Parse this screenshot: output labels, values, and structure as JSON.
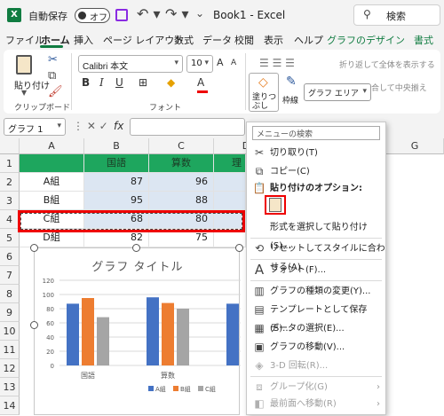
{
  "titlebar": {
    "autosave_label": "自動保存",
    "autosave_state": "オフ",
    "doc_title": "Book1  -  Excel",
    "search_label": "検索"
  },
  "tabs": [
    "ファイル",
    "ホーム",
    "挿入",
    "ページ レイアウト",
    "数式",
    "データ",
    "校閲",
    "表示",
    "ヘルプ",
    "グラフのデザイン",
    "書式"
  ],
  "ribbon": {
    "paste_label": "貼り付け",
    "clipboard_group": "クリップボード",
    "font_name": "Calibri 本文",
    "font_size": "10",
    "font_group": "フォント",
    "wrap_text": "折り返して全体を表示する",
    "merge_text": "セルを結合して中央揃え",
    "fill_label": "塗りつぶし",
    "outline_label": "枠線",
    "area_select": "グラフ エリア"
  },
  "formula_bar": {
    "name_box": "グラフ 1",
    "fx": "fx"
  },
  "grid": {
    "columns": [
      "A",
      "B",
      "C",
      "D",
      "E",
      "F",
      "G"
    ],
    "rows": [
      "1",
      "2",
      "3",
      "4",
      "5",
      "6",
      "7",
      "8",
      "9",
      "10",
      "11",
      "12",
      "13",
      "14",
      "15"
    ],
    "header_row": [
      "",
      "国語",
      "算数",
      "理"
    ],
    "data_rows": [
      [
        "A組",
        "87",
        "96"
      ],
      [
        "B組",
        "95",
        "88"
      ],
      [
        "C組",
        "68",
        "80"
      ],
      [
        "D組",
        "82",
        "75"
      ]
    ]
  },
  "chart_data": {
    "type": "bar",
    "title": "グラフ タイトル",
    "categories": [
      "国語",
      "算数",
      "理科"
    ],
    "series": [
      {
        "name": "A組",
        "color": "#4472c4",
        "values": [
          87,
          96,
          87
        ]
      },
      {
        "name": "B組",
        "color": "#ed7d31",
        "values": [
          95,
          88,
          80
        ]
      },
      {
        "name": "C組",
        "color": "#a5a5a5",
        "values": [
          68,
          80,
          92
        ]
      }
    ],
    "y_ticks": [
      "0",
      "20",
      "40",
      "60",
      "80",
      "100",
      "120"
    ],
    "ylim": [
      0,
      120
    ],
    "legend_position": "bottom",
    "grid": true
  },
  "context_menu": {
    "search_placeholder": "メニューの検索",
    "items": [
      {
        "label": "切り取り(T)",
        "icon": "scissors-icon",
        "enabled": true
      },
      {
        "label": "コピー(C)",
        "icon": "copy-icon",
        "enabled": true
      },
      {
        "label": "貼り付けのオプション:",
        "icon": "paste-icon",
        "enabled": true,
        "bold": true
      },
      {
        "label": "形式を選択して貼り付け(S)...",
        "icon": "",
        "enabled": true
      },
      {
        "label": "リセットしてスタイルに合わせる(A)",
        "icon": "reset-style-icon",
        "enabled": true
      },
      {
        "label": "フォント(F)...",
        "icon": "font-icon",
        "enabled": true
      },
      {
        "label": "グラフの種類の変更(Y)...",
        "icon": "chart-type-icon",
        "enabled": true
      },
      {
        "label": "テンプレートとして保存(S)...",
        "icon": "save-template-icon",
        "enabled": true
      },
      {
        "label": "データの選択(E)...",
        "icon": "select-data-icon",
        "enabled": true
      },
      {
        "label": "グラフの移動(V)...",
        "icon": "move-chart-icon",
        "enabled": true
      },
      {
        "label": "3-D 回転(R)...",
        "icon": "rotate-3d-icon",
        "enabled": false
      },
      {
        "label": "グループ化(G)",
        "icon": "group-icon",
        "enabled": false,
        "submenu": true
      },
      {
        "label": "最前面へ移動(R)",
        "icon": "bring-front-icon",
        "enabled": false,
        "submenu": true
      },
      {
        "label": "最背面へ移動(K)",
        "icon": "send-back-icon",
        "enabled": false,
        "submenu": true
      }
    ]
  }
}
